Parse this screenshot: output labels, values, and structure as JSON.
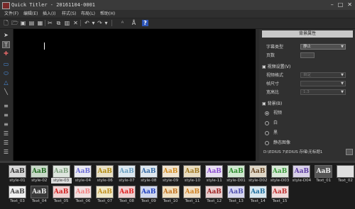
{
  "window": {
    "title": "Quick Titler - 20161104-0001",
    "controls": [
      "–",
      "□",
      "✕"
    ]
  },
  "menu": [
    "文件(F)",
    "编辑(E)",
    "插入(I)",
    "样式(S)",
    "布局(L)",
    "帮助(H)"
  ],
  "toolbar": {
    "icons": [
      "new-icon",
      "open-icon",
      "save-icon",
      "save-as-icon",
      "image-icon",
      "cut-icon",
      "copy-icon",
      "paste-icon",
      "delete-icon",
      "undo-icon",
      "redo-icon",
      "text-style-icon",
      "text-style-2-icon",
      "help-icon"
    ],
    "help_label": "?"
  },
  "tools": [
    "selection-tool",
    "text-tool",
    "image-tool",
    "rectangle-tool",
    "ellipse-tool",
    "triangle-tool",
    "line-tool",
    "align-left-tool",
    "align-center-tool",
    "align-right-tool",
    "align-top-tool",
    "align-middle-tool",
    "align-bottom-tool"
  ],
  "properties": {
    "header": "背景属性",
    "subtitle_type_label": "字幕类型",
    "subtitle_type_value": "静止",
    "pages_label": "页数",
    "video_section": "视频设置(V)",
    "video_format_label": "视频格式",
    "video_format_value": "自定",
    "frame_size_label": "帧尺寸",
    "aspect_label": "宽高比",
    "aspect_value": "1.3",
    "bg_section": "背景(B)",
    "bg_options": [
      "视频",
      "白",
      "黑",
      "静态图像"
    ],
    "bg_checked": 0,
    "path_text": "D:\\EDIUS 7\\EDIUS 存储\\无标题1"
  },
  "styles": {
    "row1": [
      {
        "label": "style-01",
        "text": "AaB",
        "bg": "#d8d8d8",
        "fg": "#333333"
      },
      {
        "label": "style-02",
        "text": "AaB",
        "bg": "#c8d8c8",
        "fg": "#1f6a1f"
      },
      {
        "label": "style-03",
        "text": "AaB",
        "bg": "#dfe6df",
        "fg": "#7fa07f"
      },
      {
        "label": "style-04",
        "text": "AaB",
        "bg": "#e8e8f0",
        "fg": "#6b6bd6"
      },
      {
        "label": "style-06",
        "text": "AaB",
        "bg": "#e8e0c8",
        "fg": "#b08a10"
      },
      {
        "label": "style-07",
        "text": "AaB",
        "bg": "#dde8f0",
        "fg": "#6a9fc0"
      },
      {
        "label": "style-08",
        "text": "AaB",
        "bg": "#dfe8f0",
        "fg": "#3a6ea8"
      },
      {
        "label": "style-09",
        "text": "AaB",
        "bg": "#f0e4d0",
        "fg": "#d08a20"
      },
      {
        "label": "style-10",
        "text": "AaB",
        "bg": "#e8dcc0",
        "fg": "#a07820"
      },
      {
        "label": "style-11",
        "text": "AaB",
        "bg": "#e8e0f0",
        "fg": "#8a4ad0"
      },
      {
        "label": "style-D01",
        "text": "AaB",
        "bg": "#d0e8d0",
        "fg": "#2a8a2a"
      },
      {
        "label": "style-D02",
        "text": "AaB",
        "bg": "#e0d8c8",
        "fg": "#6a4a2a"
      },
      {
        "label": "style-D03",
        "text": "AaB",
        "bg": "#d8e8d8",
        "fg": "#3a9a3a"
      },
      {
        "label": "style-D04",
        "text": "AaB",
        "bg": "#d8d0e8",
        "fg": "#5a3aa0"
      },
      {
        "label": "Text_01",
        "text": "AaB",
        "bg": "#555555",
        "fg": "#f0f0f0"
      },
      {
        "label": "Text_02",
        "text": "",
        "bg": "#e0e0e0",
        "fg": "#ffffff"
      }
    ],
    "row2": [
      {
        "label": "Text_03",
        "text": "AaB",
        "bg": "#f0f0f0",
        "fg": "#444444"
      },
      {
        "label": "Text_04",
        "text": "AaB",
        "bg": "#3a3a3a",
        "fg": "#e8e8e8"
      },
      {
        "label": "Text_05",
        "text": "AaB",
        "bg": "#f0d0d0",
        "fg": "#d02020"
      },
      {
        "label": "Text_06",
        "text": "AaB",
        "bg": "#f0e0e0",
        "fg": "#f08080"
      },
      {
        "label": "Text_07",
        "text": "AaB",
        "bg": "#f0e8c8",
        "fg": "#c09020"
      },
      {
        "label": "Text_08",
        "text": "AaB",
        "bg": "#f0d0d0",
        "fg": "#e02020"
      },
      {
        "label": "Text_09",
        "text": "AaB",
        "bg": "#d0d8f0",
        "fg": "#2040c0"
      },
      {
        "label": "Text_10",
        "text": "AaB",
        "bg": "#f0e0c0",
        "fg": "#c07020"
      },
      {
        "label": "Text_11",
        "text": "AaB",
        "bg": "#f0e0c8",
        "fg": "#d08020"
      },
      {
        "label": "Text_12",
        "text": "AaB",
        "bg": "#e8d0d0",
        "fg": "#a02020"
      },
      {
        "label": "Text_13",
        "text": "AaB",
        "bg": "#d8d8f0",
        "fg": "#5050b0"
      },
      {
        "label": "Text_14",
        "text": "AaB",
        "bg": "#d8e8f0",
        "fg": "#2070a0"
      },
      {
        "label": "Text_15",
        "text": "AaB",
        "bg": "#f0d8d8",
        "fg": "#c03030"
      }
    ],
    "selected": "style-03"
  }
}
